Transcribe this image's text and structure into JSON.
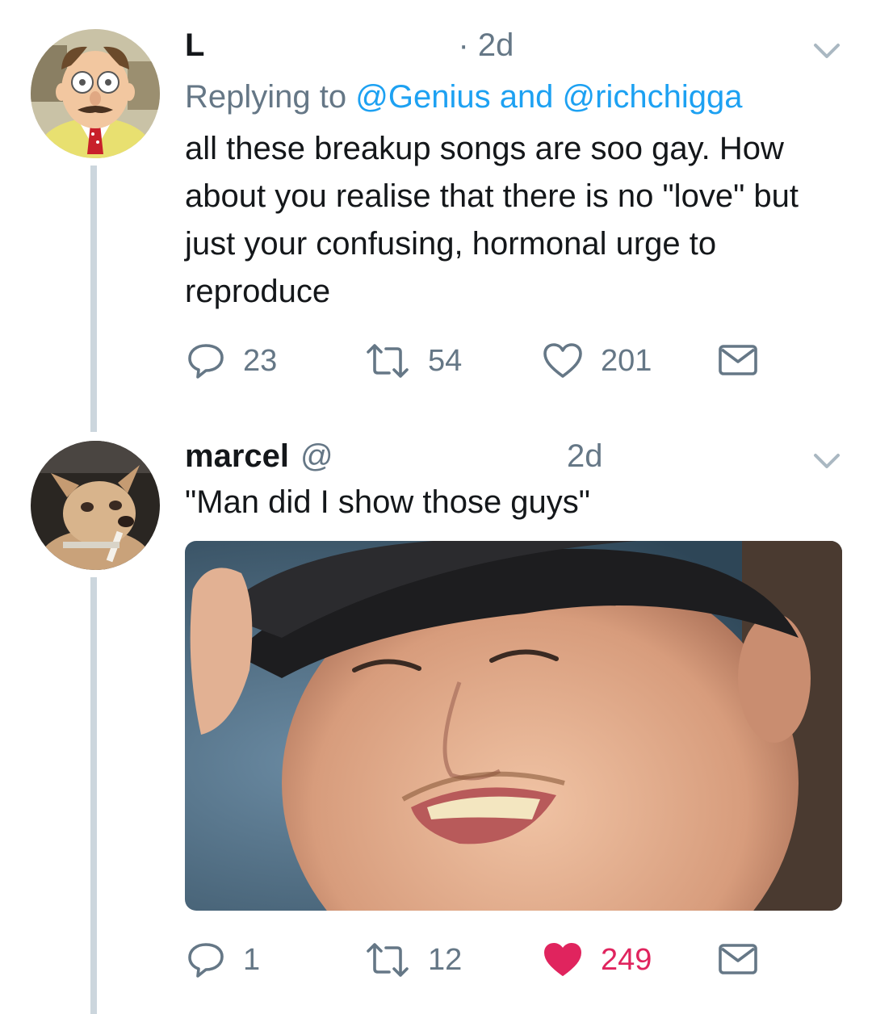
{
  "tweets": [
    {
      "name": "L",
      "handle": "",
      "time": "· 2d",
      "reply": {
        "prefix": "Replying to ",
        "user1": "@Genius",
        "and": " and ",
        "user2": "@richchigga"
      },
      "text": "all these breakup songs are soo gay. How about you realise that there is no \"love\" but just your confusing, hormonal urge to reproduce",
      "actions": {
        "replies": "23",
        "retweets": "54",
        "likes": "201"
      },
      "liked": false
    },
    {
      "name": "marcel",
      "handle": "@",
      "time": "2d",
      "text": "\"Man did I show those guys\"",
      "actions": {
        "replies": "1",
        "retweets": "12",
        "likes": "249"
      },
      "liked": true
    }
  ],
  "colors": {
    "text": "#14171a",
    "secondary": "#657786",
    "link": "#1da1f2",
    "like_active": "#e0245e",
    "thread_line": "#ccd6dd"
  },
  "icons": [
    "reply-icon",
    "retweet-icon",
    "like-icon",
    "message-icon",
    "chevron-down-icon"
  ]
}
